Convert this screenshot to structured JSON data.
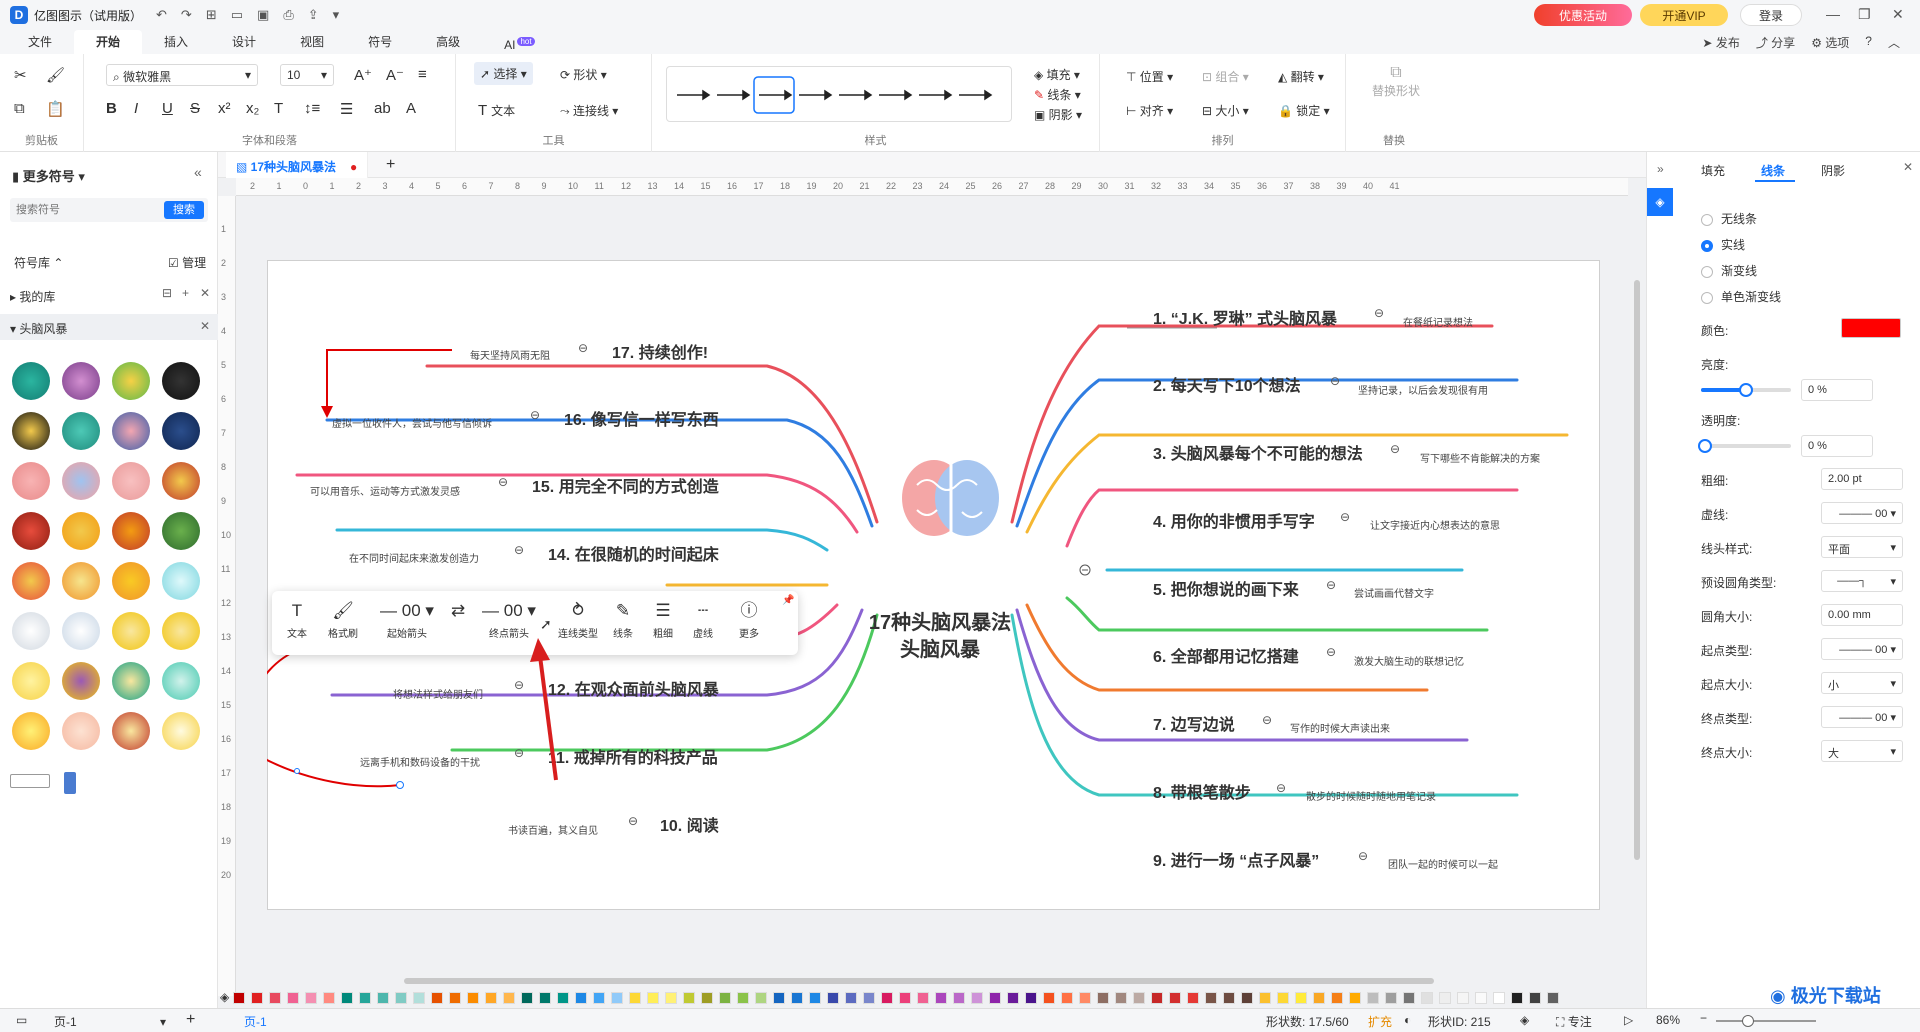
{
  "app": {
    "title": "亿图图示（试用版）",
    "promo": "优惠活动",
    "vip": "开通VIP",
    "login": "登录"
  },
  "menu": {
    "items": [
      "文件",
      "开始",
      "插入",
      "设计",
      "视图",
      "符号",
      "高级",
      "AI"
    ],
    "active": "开始",
    "ai_badge": "hot",
    "right": [
      "发布",
      "分享",
      "选项"
    ]
  },
  "ribbon": {
    "font_name": "微软雅黑",
    "font_size": "10",
    "group_clipboard": "剪贴板",
    "group_font": "字体和段落",
    "group_tools": "工具",
    "group_style": "样式",
    "group_arrange": "排列",
    "group_replace": "替换",
    "select": "选择",
    "shape": "形状",
    "text": "文本",
    "connector": "连接线",
    "fill": "填充",
    "line": "线条",
    "shadow": "阴影",
    "position": "位置",
    "group": "组合",
    "flip": "翻转",
    "align": "对齐",
    "size": "大小",
    "lock": "锁定",
    "replace_shape": "替换形状"
  },
  "left": {
    "title": "更多符号",
    "search_placeholder": "搜索符号",
    "search_btn": "搜索",
    "library": "符号库",
    "manage": "管理",
    "my_lib": "我的库",
    "category": "头脑风暴"
  },
  "tab": {
    "name": "17种头脑风暴法"
  },
  "ruler_h": [
    "2",
    "1",
    "0",
    "1",
    "2",
    "3",
    "4",
    "5",
    "6",
    "7",
    "8",
    "9",
    "10",
    "11",
    "12",
    "13",
    "14",
    "15",
    "16",
    "17",
    "18",
    "19",
    "20",
    "21",
    "22",
    "23",
    "24",
    "25",
    "26",
    "27",
    "28",
    "29",
    "30",
    "31",
    "32",
    "33",
    "34",
    "35",
    "36",
    "37",
    "38",
    "39",
    "40",
    "41"
  ],
  "ruler_v": [
    "1",
    "2",
    "3",
    "4",
    "5",
    "6",
    "7",
    "8",
    "9",
    "10",
    "11",
    "12",
    "13",
    "14",
    "15",
    "16",
    "17",
    "18",
    "19",
    "20"
  ],
  "mindmap": {
    "center_line1": "17种头脑风暴法",
    "center_line2": "头脑风暴",
    "right_nodes": [
      {
        "title": "1. “J.K. 罗琳” 式头脑风暴",
        "note": "在餐纸记录想法",
        "color": "#e8505b"
      },
      {
        "title": "2. 每天写下10个想法",
        "note": "坚持记录，以后会发现很有用",
        "color": "#2f7de1"
      },
      {
        "title": "3. 头脑风暴每个不可能的想法",
        "note": "写下哪些不肯能解决的方案",
        "color": "#f5b731"
      },
      {
        "title": "4. 用你的非惯用手写字",
        "note": "让文字接近内心想表达的意思",
        "color": "#f0567f"
      },
      {
        "title": "5. 把你想说的画下来",
        "note": "尝试画画代替文字",
        "color": "#35b7d8"
      },
      {
        "title": "6. 全部都用记忆搭建",
        "note": "激发大脑生动的联想记忆",
        "color": "#4cc95e"
      },
      {
        "title": "7. 边写边说",
        "note": "写作的时候大声读出来",
        "color": "#f07a2f"
      },
      {
        "title": "8. 带根笔散步",
        "note": "散步的时候随时随地用笔记录",
        "color": "#8a63d2"
      },
      {
        "title": "9. 进行一场 “点子风暴”",
        "note": "团队一起的时候可以一起",
        "color": "#3fc6c0"
      }
    ],
    "left_nodes": [
      {
        "title": "17. 持续创作!",
        "note": "每天坚持风雨无阻",
        "color": "#e8505b"
      },
      {
        "title": "16. 像写信一样写东西",
        "note": "虚拟一位收件人，尝试与他写信倾诉",
        "color": "#2f7de1"
      },
      {
        "title": "15. 用完全不同的方式创造",
        "note": "可以用音乐、运动等方式激发灵感",
        "color": "#f0567f"
      },
      {
        "title": "14. 在很随机的时间起床",
        "note": "在不同时间起床来激发创造力",
        "color": "#35b7d8"
      },
      {
        "title": "12. 在观众面前头脑风暴",
        "note": "将想法样式给朋友们",
        "color": "#f0567f"
      },
      {
        "title": "11. 戒掉所有的科技产品",
        "note": "远离手机和数码设备的干扰",
        "color": "#8a63d2"
      },
      {
        "title": "10. 阅读",
        "note": "书读百遍，其义自见",
        "color": "#4cc95e"
      }
    ]
  },
  "floatbar": {
    "text": "文本",
    "format_brush": "格式刷",
    "start_arrow": "起始箭头",
    "start_val": "00",
    "end_arrow": "终点箭头",
    "end_val": "00",
    "conn_type": "连线类型",
    "line": "线条",
    "weight": "粗细",
    "dash": "虚线",
    "more": "更多"
  },
  "right": {
    "tabs": [
      "填充",
      "线条",
      "阴影"
    ],
    "active_tab": "线条",
    "opt_none": "无线条",
    "opt_solid": "实线",
    "opt_gradient": "渐变线",
    "opt_single_gradient": "单色渐变线",
    "color_label": "颜色:",
    "color_value": "#ff0000",
    "brightness_label": "亮度:",
    "brightness_value": "0 %",
    "brightness_level": 0.5,
    "transparency_label": "透明度:",
    "transparency_value": "0 %",
    "transparency_level": 0,
    "weight_label": "粗细:",
    "weight_value": "2.00 pt",
    "dash_label": "虚线:",
    "dash_value": "00",
    "cap_label": "线头样式:",
    "cap_value": "平面",
    "corner_type_label": "预设圆角类型:",
    "corner_size_label": "圆角大小:",
    "corner_size_value": "0.00 mm",
    "start_type_label": "起点类型:",
    "start_type_value": "00",
    "start_size_label": "起点大小:",
    "start_size_value": "小",
    "end_type_label": "终点类型:",
    "end_type_value": "00",
    "end_size_label": "终点大小:",
    "end_size_value": "大"
  },
  "status": {
    "page_sel": "页-1",
    "page_tab": "页-1",
    "shapes": "形状数: 17.5/60",
    "expand": "扩充",
    "shape_id": "形状ID: 215",
    "focus": "专注",
    "zoom": "86%"
  },
  "watermark": "极光下载站"
}
